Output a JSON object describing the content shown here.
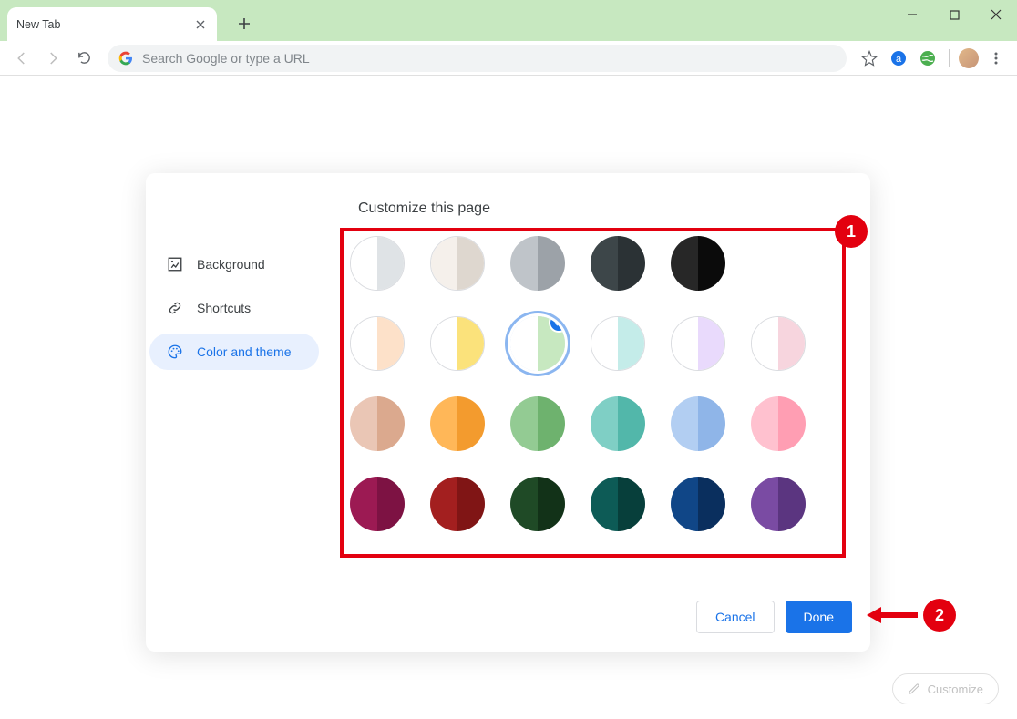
{
  "window": {
    "tab_title": "New Tab",
    "omnibox_placeholder": "Search Google or type a URL",
    "customize_label": "Customize"
  },
  "modal": {
    "title": "Customize this page",
    "sidebar": [
      {
        "label": "Background"
      },
      {
        "label": "Shortcuts"
      },
      {
        "label": "Color and theme"
      }
    ],
    "swatches": [
      {
        "l": "#ffffff",
        "r": "#dfe3e6",
        "plain": true,
        "selected": false
      },
      {
        "l": "#f5f0eb",
        "r": "#ded7cf",
        "plain": true,
        "selected": false
      },
      {
        "l": "#bfc4c9",
        "r": "#9ca2a8",
        "plain": false,
        "selected": false
      },
      {
        "l": "#3d4649",
        "r": "#2b3235",
        "plain": false,
        "selected": false
      },
      {
        "l": "#272727",
        "r": "#0b0b0b",
        "plain": false,
        "selected": false
      },
      {
        "l": "#ffffff",
        "r": "#ffffff",
        "plain": false,
        "selected": false,
        "empty": true
      },
      {
        "l": "#ffffff",
        "r": "#fde1c9",
        "plain": true,
        "selected": false
      },
      {
        "l": "#ffffff",
        "r": "#fbe27b",
        "plain": true,
        "selected": false
      },
      {
        "l": "#ffffff",
        "r": "#c7e8c0",
        "plain": false,
        "selected": true
      },
      {
        "l": "#ffffff",
        "r": "#c4ece9",
        "plain": true,
        "selected": false
      },
      {
        "l": "#ffffff",
        "r": "#e9dafc",
        "plain": true,
        "selected": false
      },
      {
        "l": "#ffffff",
        "r": "#f7d5de",
        "plain": true,
        "selected": false
      },
      {
        "l": "#eac6b5",
        "r": "#dba98e",
        "plain": false,
        "selected": false
      },
      {
        "l": "#ffb758",
        "r": "#f39b2e",
        "plain": false,
        "selected": false
      },
      {
        "l": "#93cb93",
        "r": "#6eb26e",
        "plain": false,
        "selected": false
      },
      {
        "l": "#7fcfc5",
        "r": "#52b7aa",
        "plain": false,
        "selected": false
      },
      {
        "l": "#b2cef2",
        "r": "#8fb5e8",
        "plain": false,
        "selected": false
      },
      {
        "l": "#ffc1cf",
        "r": "#ff9eb3",
        "plain": false,
        "selected": false
      },
      {
        "l": "#9c1a53",
        "r": "#7d1243",
        "plain": false,
        "selected": false
      },
      {
        "l": "#a31f1f",
        "r": "#801515",
        "plain": false,
        "selected": false
      },
      {
        "l": "#1f4a26",
        "r": "#123218",
        "plain": false,
        "selected": false
      },
      {
        "l": "#0d5b56",
        "r": "#073f3b",
        "plain": false,
        "selected": false
      },
      {
        "l": "#104687",
        "r": "#0a2f5e",
        "plain": false,
        "selected": false
      },
      {
        "l": "#7a4ba3",
        "r": "#5b3580",
        "plain": false,
        "selected": false
      }
    ],
    "footer": {
      "cancel": "Cancel",
      "done": "Done"
    }
  },
  "annotations": {
    "one": "1",
    "two": "2"
  }
}
